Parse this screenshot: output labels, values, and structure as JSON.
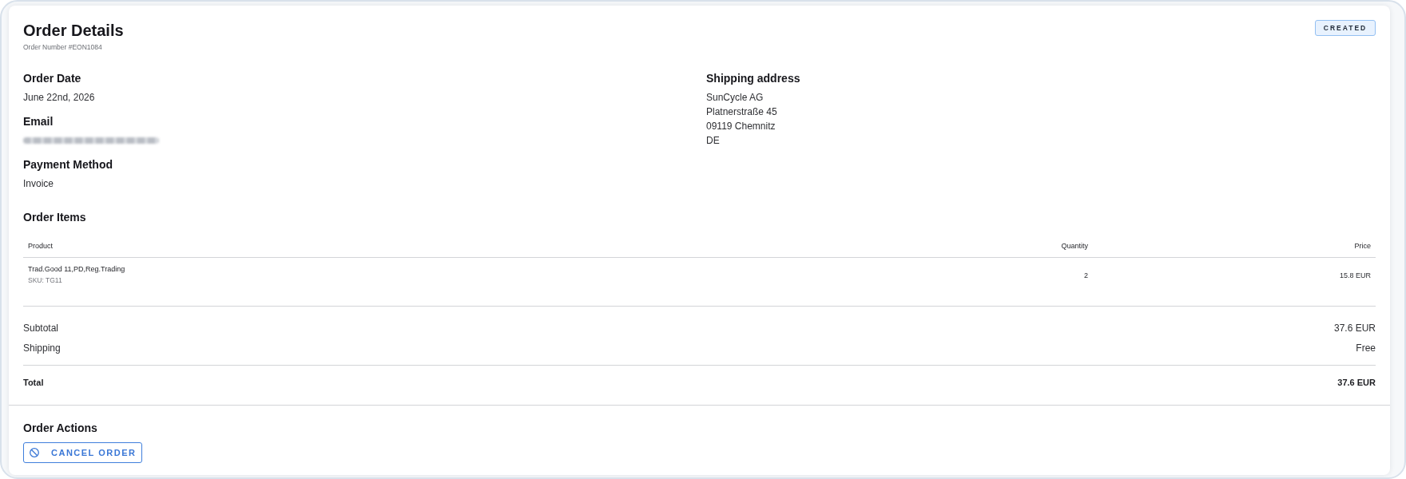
{
  "header": {
    "title": "Order Details",
    "order_number": "Order Number #EON1084",
    "status": {
      "label": "CREATED",
      "kind": "created"
    }
  },
  "info": [
    {
      "label": "Order Date",
      "value": "June 22nd, 2026",
      "redacted": false
    },
    {
      "label": "Email",
      "redacted": true
    },
    {
      "label": "Payment Method",
      "value": "Invoice",
      "redacted": false
    }
  ],
  "shipping_address": {
    "label": "Shipping address",
    "lines": [
      "SunCycle AG",
      "Platnerstraße 45",
      "09119 Chemnitz",
      "DE"
    ]
  },
  "order_items": {
    "title": "Order Items",
    "columns": [
      "Product",
      "Quantity",
      "Price"
    ],
    "rows": [
      {
        "product": "Trad.Good 11,PD,Reg.Trading",
        "sku": "SKU: TG11",
        "quantity": "2",
        "price": "15.8 EUR"
      }
    ]
  },
  "summary": [
    {
      "kind": "line",
      "label": "Subtotal",
      "value": "37.6 EUR"
    },
    {
      "kind": "line",
      "label": "Shipping",
      "value": "Free"
    },
    {
      "kind": "total",
      "label": "Total",
      "value": "37.6 EUR"
    }
  ],
  "actions": {
    "title": "Order Actions",
    "buttons": [
      {
        "kind": "cancel",
        "label": "CANCEL ORDER"
      }
    ]
  }
}
